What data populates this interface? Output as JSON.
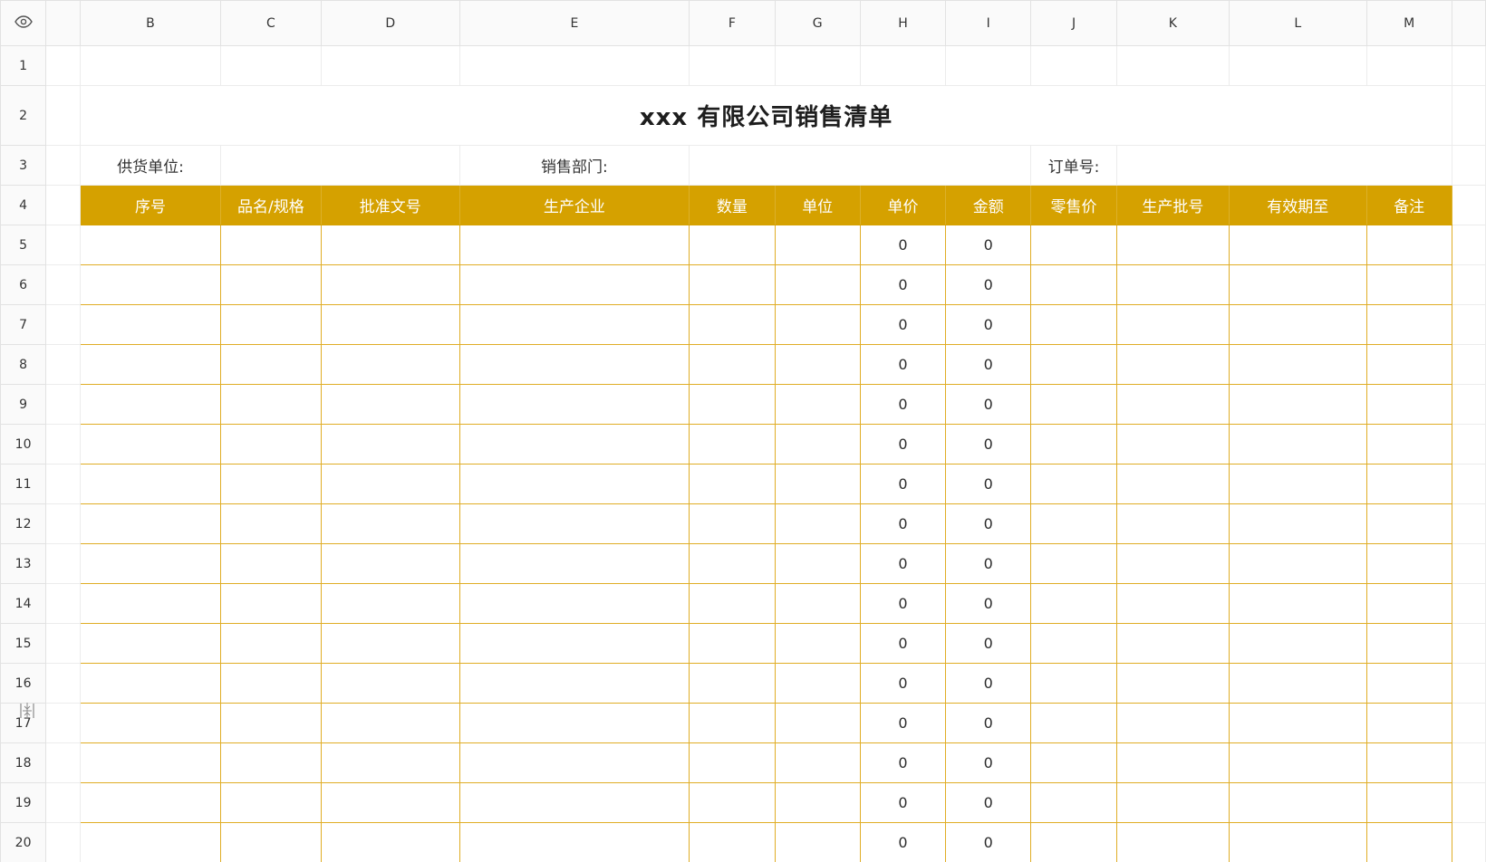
{
  "columns": [
    "B",
    "C",
    "D",
    "E",
    "F",
    "G",
    "H",
    "I",
    "J",
    "K",
    "L",
    "M"
  ],
  "rows": [
    "1",
    "2",
    "3",
    "4",
    "5",
    "6",
    "7",
    "8",
    "9",
    "10",
    "11",
    "12",
    "13",
    "14",
    "15",
    "16",
    "17",
    "18",
    "19",
    "20"
  ],
  "title": "xxx 有限公司销售清单",
  "labels": {
    "supplier": "供货单位:",
    "department": "销售部门:",
    "order_no": "订单号:"
  },
  "headers": [
    "序号",
    "品名/规格",
    "批准文号",
    "生产企业",
    "数量",
    "单位",
    "单价",
    "金额",
    "零售价",
    "生产批号",
    "有效期至",
    "备注"
  ],
  "data_rows": [
    {
      "unit_price": "0",
      "amount": "0"
    },
    {
      "unit_price": "0",
      "amount": "0"
    },
    {
      "unit_price": "0",
      "amount": "0"
    },
    {
      "unit_price": "0",
      "amount": "0"
    },
    {
      "unit_price": "0",
      "amount": "0"
    },
    {
      "unit_price": "0",
      "amount": "0"
    },
    {
      "unit_price": "0",
      "amount": "0"
    },
    {
      "unit_price": "0",
      "amount": "0"
    },
    {
      "unit_price": "0",
      "amount": "0"
    },
    {
      "unit_price": "0",
      "amount": "0"
    },
    {
      "unit_price": "0",
      "amount": "0"
    },
    {
      "unit_price": "0",
      "amount": "0"
    },
    {
      "unit_price": "0",
      "amount": "0"
    },
    {
      "unit_price": "0",
      "amount": "0"
    },
    {
      "unit_price": "0",
      "amount": "0"
    },
    {
      "unit_price": "0",
      "amount": "0"
    }
  ],
  "colors": {
    "header_fill": "#d5a100",
    "header_text": "#ffffff",
    "data_border": "#e0ad25",
    "grid_line": "#ececec"
  },
  "icons": {
    "corner": "eye-icon",
    "row_resize": "row-resize-icon"
  }
}
